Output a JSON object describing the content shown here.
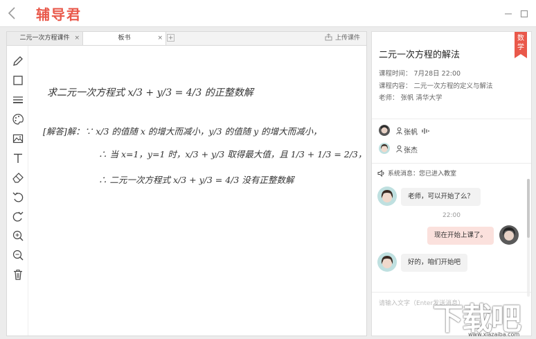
{
  "app": {
    "logo": "辅导君",
    "brand_color": "#e9584a"
  },
  "tabs": [
    {
      "label": "二元一次方程课件",
      "active": false
    },
    {
      "label": "板书",
      "active": true
    }
  ],
  "tab_add_label": "+",
  "tab_close_label": "×",
  "upload_label": "上传课件",
  "toolbar": [
    "pencil-icon",
    "rectangle-icon",
    "lines-icon",
    "palette-icon",
    "image-icon",
    "text-icon",
    "eraser-icon",
    "undo-icon",
    "redo-icon",
    "zoom-in-icon",
    "zoom-out-icon",
    "trash-icon"
  ],
  "whiteboard": {
    "line1": "求二元一次方程式 x/3 + y/3 = 4/3 的正整数解",
    "line2": "[解答]解：∵ x/3 的值随 x 的增大而减小，y/3 的值随 y 的增大而减小，",
    "line3": "∴ 当 x=1，y=1 时，x/3 + y/3 取得最大值，且 1/3 + 1/3 = 2/3，",
    "line4": "∴ 二元一次方程式 x/3 + y/3 = 4/3 没有正整数解"
  },
  "course": {
    "title": "二元一次方程的解法",
    "subject": "数学",
    "time": "课程时间：  7月28日 22:00",
    "content": "课程内容：  二元一次方程的定义与解法",
    "teacher": "老师：  张帆    清华大学"
  },
  "members": [
    {
      "name": "张帆"
    },
    {
      "name": "张杰"
    }
  ],
  "chat": {
    "system": "系统消息：您已进入教室",
    "messages": [
      {
        "text": "老师，可以开始了么？",
        "side": "left"
      },
      {
        "text": "22:00",
        "side": "time"
      },
      {
        "text": "现在开始上课了。",
        "side": "right"
      },
      {
        "text": "好的，咱们开始吧",
        "side": "left"
      }
    ],
    "placeholder": "请输入文字（Enter发送消息）"
  },
  "watermark": {
    "text": "下载吧",
    "url": "www.xiazaiba.com"
  }
}
